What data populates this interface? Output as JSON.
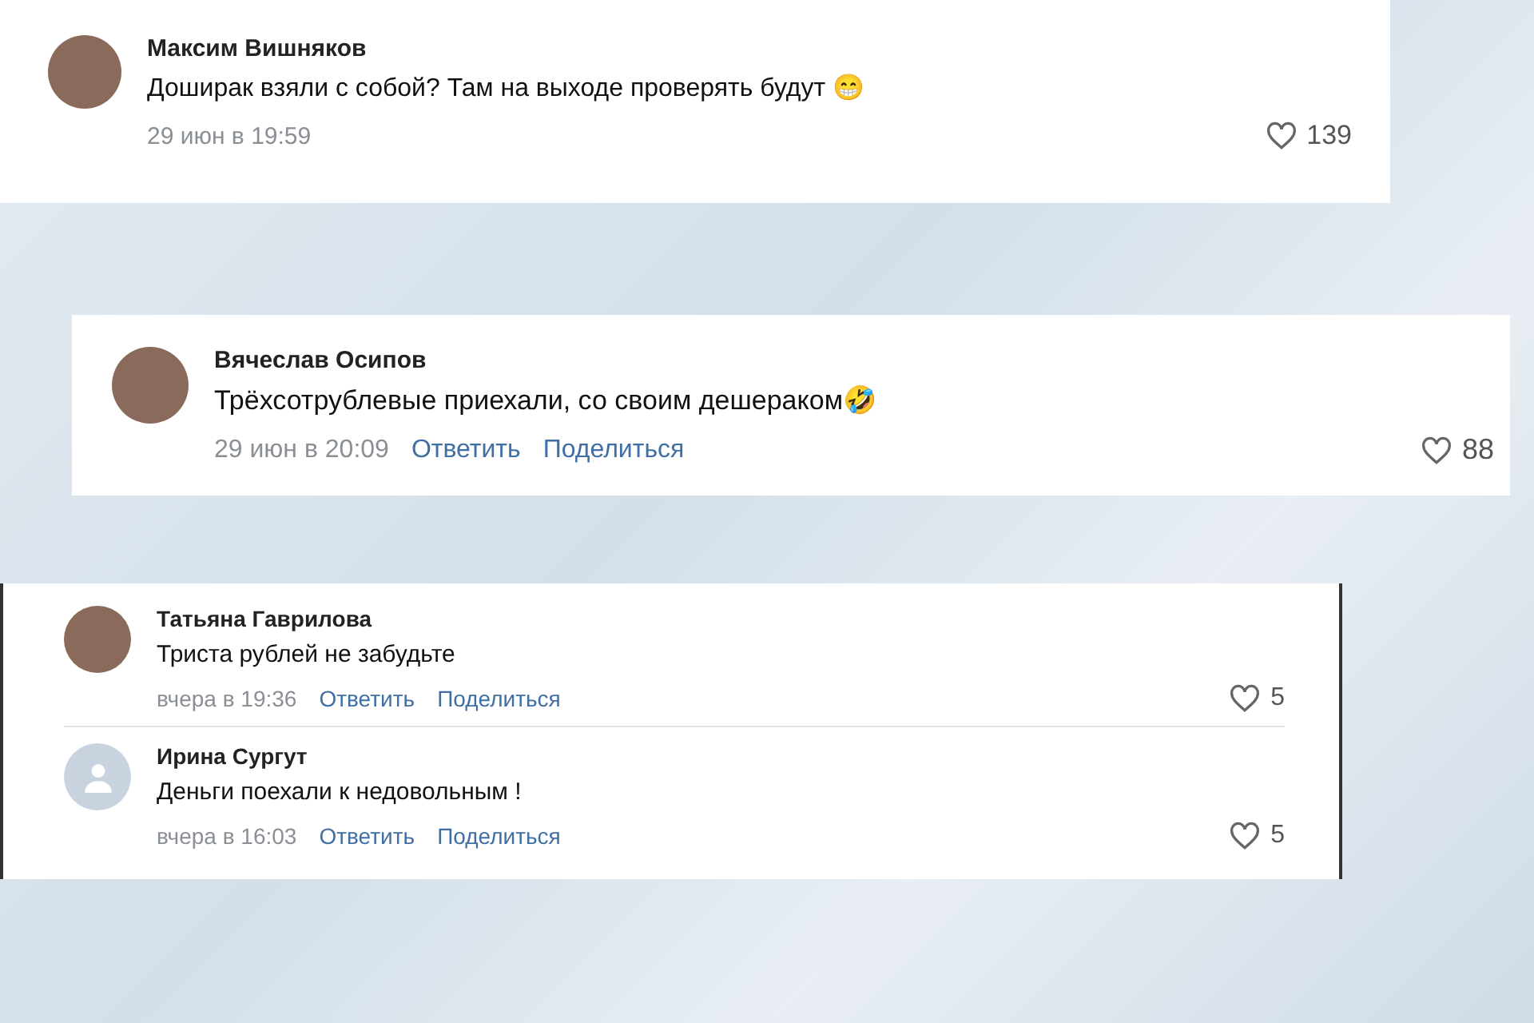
{
  "cards": [
    {
      "comments": [
        {
          "kind": "photo",
          "author": "Максим Вишняков",
          "text": "Доширак взяли с собой? Там на выходе проверять будут 😁",
          "date": "29 июн в 19:59",
          "likes": "139"
        }
      ]
    },
    {
      "comments": [
        {
          "kind": "photo",
          "author": "Вячеслав Осипов",
          "text": "Трёхсотрублевые приехали, со своим дешераком🤣",
          "date": "29 июн в 20:09",
          "actions": [
            "Ответить",
            "Поделиться"
          ],
          "likes": "88"
        }
      ]
    },
    {
      "comments": [
        {
          "kind": "photo",
          "author": "Татьяна Гаврилова",
          "text": "Триста рублей не забудьте",
          "date": "вчера в 19:36",
          "actions": [
            "Ответить",
            "Поделиться"
          ],
          "likes": "5"
        },
        {
          "kind": "default",
          "author": "Ирина Сургут",
          "text": "Деньги поехали к недовольным !",
          "date": "вчера в 16:03",
          "actions": [
            "Ответить",
            "Поделиться"
          ],
          "likes": "5"
        }
      ]
    }
  ]
}
